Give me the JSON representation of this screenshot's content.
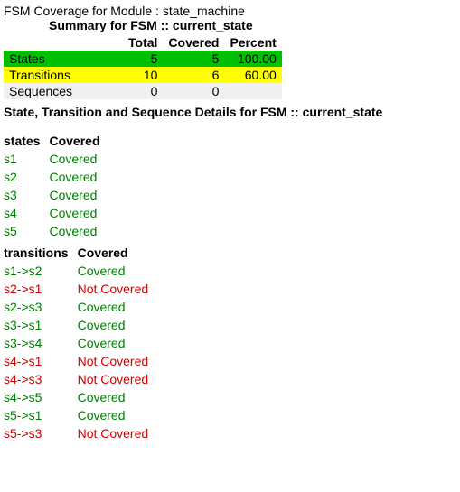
{
  "title": "FSM Coverage for Module : state_machine",
  "subtitle": "Summary for FSM :: current_state",
  "summary": {
    "headers": {
      "total": "Total",
      "covered": "Covered",
      "percent": "Percent"
    },
    "rows": [
      {
        "label": "States",
        "total": "5",
        "covered": "5",
        "percent": "100.00",
        "cls": "row-green"
      },
      {
        "label": "Transitions",
        "total": "10",
        "covered": "6",
        "percent": "60.00",
        "cls": "row-yellow"
      },
      {
        "label": "Sequences",
        "total": "0",
        "covered": "0",
        "percent": "",
        "cls": "row-gray"
      }
    ]
  },
  "details_header": "State, Transition and Sequence Details for FSM :: current_state",
  "states": {
    "col1": "states",
    "col2": "Covered",
    "rows": [
      {
        "name": "s1",
        "status": "Covered",
        "cls": "covered"
      },
      {
        "name": "s2",
        "status": "Covered",
        "cls": "covered"
      },
      {
        "name": "s3",
        "status": "Covered",
        "cls": "covered"
      },
      {
        "name": "s4",
        "status": "Covered",
        "cls": "covered"
      },
      {
        "name": "s5",
        "status": "Covered",
        "cls": "covered"
      }
    ]
  },
  "transitions": {
    "col1": "transitions",
    "col2": "Covered",
    "rows": [
      {
        "name": "s1->s2",
        "status": "Covered",
        "cls": "covered"
      },
      {
        "name": "s2->s1",
        "status": "Not Covered",
        "cls": "notcovered"
      },
      {
        "name": "s2->s3",
        "status": "Covered",
        "cls": "covered"
      },
      {
        "name": "s3->s1",
        "status": "Covered",
        "cls": "covered"
      },
      {
        "name": "s3->s4",
        "status": "Covered",
        "cls": "covered"
      },
      {
        "name": "s4->s1",
        "status": "Not Covered",
        "cls": "notcovered"
      },
      {
        "name": "s4->s3",
        "status": "Not Covered",
        "cls": "notcovered"
      },
      {
        "name": "s4->s5",
        "status": "Covered",
        "cls": "covered"
      },
      {
        "name": "s5->s1",
        "status": "Covered",
        "cls": "covered"
      },
      {
        "name": "s5->s3",
        "status": "Not Covered",
        "cls": "notcovered"
      }
    ]
  }
}
